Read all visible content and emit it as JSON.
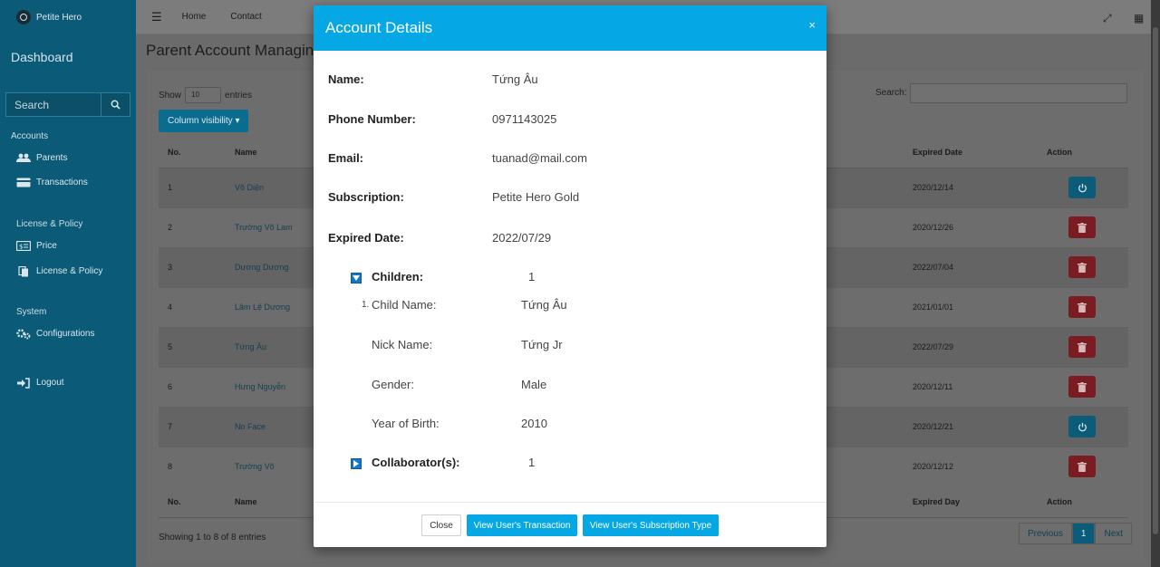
{
  "sidebar": {
    "brand": "Petite Hero",
    "dashboard": "Dashboard",
    "search_placeholder": "Search",
    "sections": {
      "accounts": "Accounts",
      "license": "License & Policy",
      "system": "System"
    },
    "items": {
      "parents": "Parents",
      "transactions": "Transactions",
      "price": "Price",
      "license_policy": "License & Policy",
      "configurations": "Configurations",
      "logout": "Logout"
    }
  },
  "topbar": {
    "home": "Home",
    "contact": "Contact"
  },
  "page": {
    "title": "Parent Account Managing",
    "show_label": "Show",
    "show_value": "10",
    "entries_label": "entries",
    "column_visibility": "Column visibility ▾",
    "search_label": "Search:",
    "table": {
      "headers": {
        "no": "No.",
        "name": "Name",
        "expired": "Expired Date",
        "action": "Action"
      },
      "footers": {
        "no": "No.",
        "name": "Name",
        "expired": "Expired Day",
        "action": "Action"
      },
      "rows": [
        {
          "no": "1",
          "name": "Võ Diện",
          "expired": "2020/12/14",
          "action": "power"
        },
        {
          "no": "2",
          "name": "Trường Võ Lam",
          "expired": "2020/12/26",
          "action": "delete"
        },
        {
          "no": "3",
          "name": "Dương Dương",
          "expired": "2022/07/04",
          "action": "delete"
        },
        {
          "no": "4",
          "name": "Lâm Lệ Dương",
          "expired": "2021/01/01",
          "action": "delete"
        },
        {
          "no": "5",
          "name": "Tứng Âu",
          "expired": "2022/07/29",
          "action": "delete"
        },
        {
          "no": "6",
          "name": "Hưng Nguyễn",
          "expired": "2020/12/11",
          "action": "delete"
        },
        {
          "no": "7",
          "name": "No Face",
          "expired": "2020/12/21",
          "action": "power"
        },
        {
          "no": "8",
          "name": "Trường Võ",
          "expired": "2020/12/12",
          "action": "delete"
        }
      ]
    },
    "showing": "Showing 1 to 8 of 8 entries",
    "pager": {
      "previous": "Previous",
      "current": "1",
      "next": "Next"
    }
  },
  "modal": {
    "title": "Account Details",
    "close_x": "×",
    "fields": {
      "name_label": "Name:",
      "name_value": "Tứng Âu",
      "phone_label": "Phone Number:",
      "phone_value": "0971143025",
      "email_label": "Email:",
      "email_value": "tuanad@mail.com",
      "subscription_label": "Subscription:",
      "subscription_value": "Petite Hero Gold",
      "expired_label": "Expired Date:",
      "expired_value": "2022/07/29"
    },
    "children": {
      "label": "Children:",
      "count": "1",
      "index": "1.",
      "child_name_label": "Child Name:",
      "child_name_value": "Tứng Âu",
      "nick_label": "Nick Name:",
      "nick_value": "Tứng Jr",
      "gender_label": "Gender:",
      "gender_value": "Male",
      "yob_label": "Year of Birth:",
      "yob_value": "2010"
    },
    "collaborators": {
      "label": "Collaborator(s):",
      "count": "1"
    },
    "buttons": {
      "close": "Close",
      "transaction": "View User's Transaction",
      "subscription": "View User's Subscription Type"
    }
  }
}
